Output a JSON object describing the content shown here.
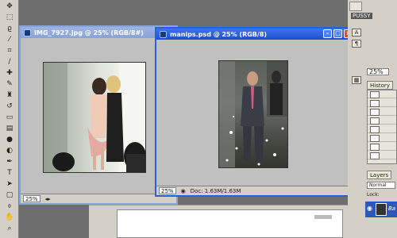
{
  "windows": [
    {
      "title": "IMG_7927.jpg @ 25% (RGB/8#)",
      "zoom": "25%"
    },
    {
      "title": "manips.psd @ 25% (RGB/8)",
      "zoom": "25%",
      "doc_info": "Doc: 1.63M/1.63M"
    }
  ],
  "right_dock": {
    "brush_label": "PUSSY",
    "zoom_field": "25%",
    "history_tab": "History",
    "layers_tab": "Layers",
    "blend_mode": "Normal",
    "lock_label": "Lock:",
    "layer_name": "Ba"
  },
  "colors": {
    "active_title": "#1d4fd0",
    "inactive_title": "#8aa3d6",
    "workspace": "#6e6e6e",
    "panel": "#d4d0c8"
  },
  "icons": [
    "move-icon",
    "marquee-icon",
    "lasso-icon",
    "magic-wand-icon",
    "crop-icon",
    "slice-icon",
    "healing-icon",
    "brush-icon",
    "stamp-icon",
    "history-brush-icon",
    "eraser-icon",
    "gradient-icon",
    "blur-icon",
    "dodge-icon",
    "pen-icon",
    "type-icon",
    "path-select-icon",
    "shape-icon",
    "notes-icon",
    "eyedropper-icon",
    "hand-icon",
    "zoom-icon"
  ]
}
